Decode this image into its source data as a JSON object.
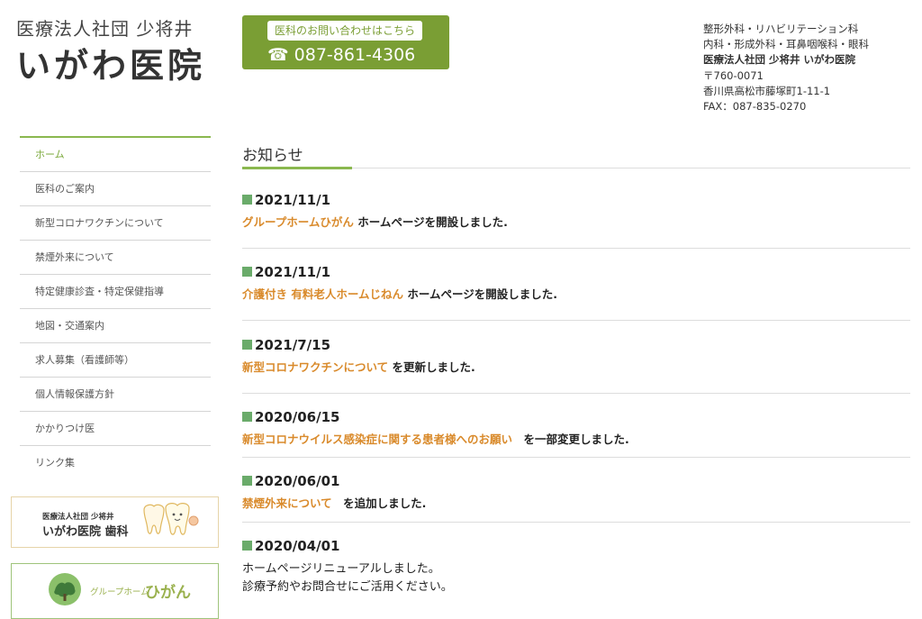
{
  "header": {
    "logo_sub": "医療法人社団 少将井",
    "logo_main": "いがわ医院",
    "contact_label": "医科のお問い合わせはこちら",
    "contact_phone_icon": "☎",
    "contact_phone": "087-861-4306",
    "info_line1": "整形外科・リハビリテーション科",
    "info_line2": "内科・形成外科・耳鼻咽喉科・眼科",
    "info_line3": "医療法人社団 少将井 いがわ医院",
    "info_line4": "〒760-0071",
    "info_line5": "香川県高松市藤塚町1-11-1",
    "info_line6": "FAX：087-835-0270"
  },
  "sidebar": {
    "items": [
      {
        "label": "ホーム"
      },
      {
        "label": "医科のご案内"
      },
      {
        "label": "新型コロナワクチンについて"
      },
      {
        "label": "禁煙外来について"
      },
      {
        "label": "特定健康診査・特定保健指導"
      },
      {
        "label": "地図・交通案内"
      },
      {
        "label": "求人募集（看護師等）"
      },
      {
        "label": "個人情報保護方針"
      },
      {
        "label": "かかりつけ医"
      },
      {
        "label": "リンク集"
      }
    ],
    "banner1_small": "医療法人社団 少将井",
    "banner1_large": "いがわ医院 歯科",
    "banner2_small": "グループホーム",
    "banner2_large": "ひがん"
  },
  "main": {
    "title": "お知らせ",
    "news": [
      {
        "date": "2021/11/1",
        "link": "グループホームひがん",
        "text": " ホームページを開設しました."
      },
      {
        "date": "2021/11/1",
        "link": "介護付き 有料老人ホームじねん",
        "text": " ホームページを開設しました."
      },
      {
        "date": "2021/7/15",
        "link": "新型コロナワクチンについて",
        "text": " を更新しました."
      },
      {
        "date": "2020/06/15",
        "link": "新型コロナウイルス感染症に関する患者様へのお願い",
        "text": "　を一部変更しました."
      },
      {
        "date": "2020/06/01",
        "link": "禁煙外来について",
        "text": "　を追加しました."
      },
      {
        "date": "2020/04/01",
        "line1": "ホームページリニューアルしました。",
        "line2": "診療予約やお問合せにご活用ください。"
      }
    ]
  },
  "colors": {
    "accent_green": "#7a9e34",
    "link_orange": "#d98a2b",
    "date_square": "#6aab6a"
  }
}
